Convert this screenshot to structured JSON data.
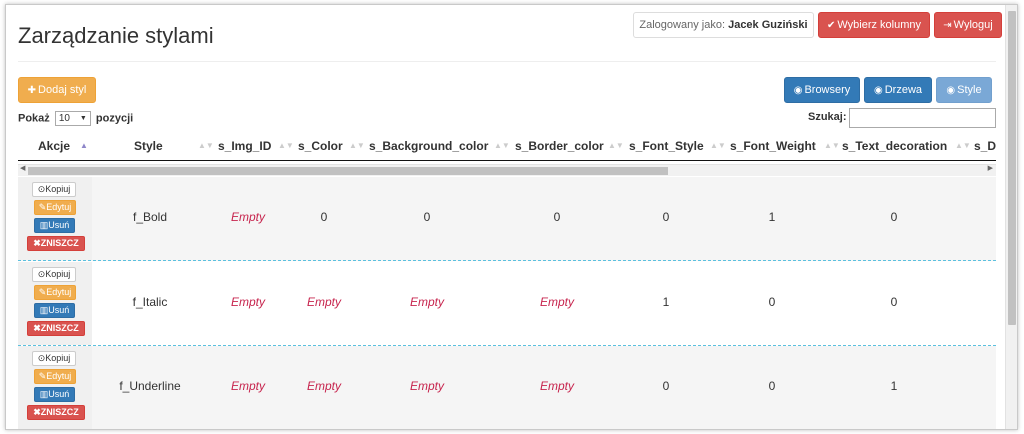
{
  "header": {
    "title": "Zarządzanie stylami",
    "logged_as_label": "Zalogowany jako:",
    "logged_user": "Jacek Guziński",
    "choose_columns_label": "Wybierz kolumny",
    "logout_label": "Wyloguj"
  },
  "toolbar": {
    "add_style_label": "Dodaj styl",
    "browsers_label": "Browsery",
    "trees_label": "Drzewa",
    "styles_label": "Style"
  },
  "table_controls": {
    "show_label": "Pokaż",
    "show_value": "10",
    "entries_label": "pozycji",
    "search_label": "Szukaj:",
    "search_value": ""
  },
  "columns": [
    "Akcje",
    "Style",
    "s_Img_ID",
    "s_Color",
    "s_Background_color",
    "s_Border_color",
    "s_Font_Style",
    "s_Font_Weight",
    "s_Text_decoration",
    "s_D"
  ],
  "row_actions": {
    "copy": "Kopiuj",
    "edit": "Edytuj",
    "delete": "Usuń",
    "destroy": "ZNISZCZ"
  },
  "rows": [
    [
      "f_Bold",
      "Empty",
      "0",
      "0",
      "0",
      "0",
      "1",
      "0"
    ],
    [
      "f_Italic",
      "Empty",
      "Empty",
      "Empty",
      "Empty",
      "1",
      "0",
      "0"
    ],
    [
      "f_Underline",
      "Empty",
      "Empty",
      "Empty",
      "Empty",
      "0",
      "0",
      "1"
    ]
  ],
  "colors": {
    "danger": "#d9534f",
    "warning": "#f0ad4e",
    "primary": "#337ab7",
    "empty_text": "#c7254e"
  }
}
